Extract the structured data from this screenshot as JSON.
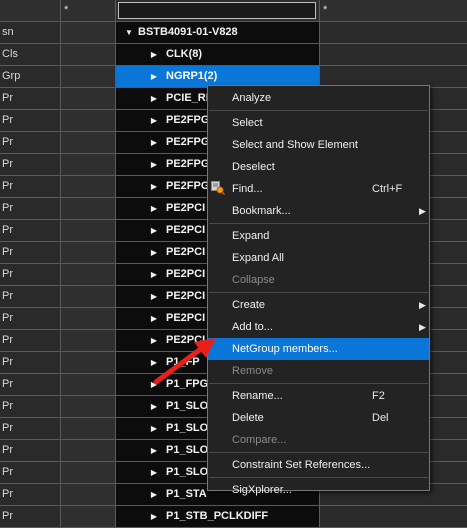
{
  "header": {
    "col1_filter": "*",
    "col3_filter": "*"
  },
  "rows": [
    {
      "c0": "sn",
      "tree": "BSTB4091-01-V828",
      "level": 1,
      "expanded": true
    },
    {
      "c0": "Cls",
      "tree": "CLK(8)",
      "level": 2
    },
    {
      "c0": "Grp",
      "tree": "NGRP1(2)",
      "level": 2,
      "selected": true
    },
    {
      "c0": "Pr",
      "tree": "PCIE_RE",
      "level": 2
    },
    {
      "c0": "Pr",
      "tree": "PE2FPG",
      "level": 2
    },
    {
      "c0": "Pr",
      "tree": "PE2FPG",
      "level": 2
    },
    {
      "c0": "Pr",
      "tree": "PE2FPG",
      "level": 2
    },
    {
      "c0": "Pr",
      "tree": "PE2FPG",
      "level": 2
    },
    {
      "c0": "Pr",
      "tree": "PE2PCI",
      "level": 2
    },
    {
      "c0": "Pr",
      "tree": "PE2PCI",
      "level": 2
    },
    {
      "c0": "Pr",
      "tree": "PE2PCI",
      "level": 2
    },
    {
      "c0": "Pr",
      "tree": "PE2PCI",
      "level": 2
    },
    {
      "c0": "Pr",
      "tree": "PE2PCI",
      "level": 2
    },
    {
      "c0": "Pr",
      "tree": "PE2PCI",
      "level": 2
    },
    {
      "c0": "Pr",
      "tree": "PE2PCI",
      "level": 2
    },
    {
      "c0": "Pr",
      "tree": "P1_FP",
      "level": 2
    },
    {
      "c0": "Pr",
      "tree": "P1_FPG",
      "level": 2
    },
    {
      "c0": "Pr",
      "tree": "P1_SLO",
      "level": 2
    },
    {
      "c0": "Pr",
      "tree": "P1_SLO",
      "level": 2
    },
    {
      "c0": "Pr",
      "tree": "P1_SLO",
      "level": 2
    },
    {
      "c0": "Pr",
      "tree": "P1_SLO",
      "level": 2
    },
    {
      "c0": "Pr",
      "tree": "P1_STA",
      "level": 2
    },
    {
      "c0": "Pr",
      "tree": "P1_STB_PCLKDIFF",
      "level": 2
    }
  ],
  "menu": [
    {
      "label": "Analyze"
    },
    {
      "sep": true
    },
    {
      "label": "Select"
    },
    {
      "label": "Select and Show Element"
    },
    {
      "label": "Deselect"
    },
    {
      "label": "Find...",
      "shortcut": "Ctrl+F",
      "icon": "find-icon"
    },
    {
      "label": "Bookmark...",
      "submenu": true
    },
    {
      "sep": true
    },
    {
      "label": "Expand"
    },
    {
      "label": "Expand All"
    },
    {
      "label": "Collapse",
      "disabled": true
    },
    {
      "sep": true
    },
    {
      "label": "Create",
      "submenu": true
    },
    {
      "label": "Add to...",
      "submenu": true
    },
    {
      "label": "NetGroup members...",
      "highlighted": true
    },
    {
      "label": "Remove",
      "disabled": true
    },
    {
      "sep": true
    },
    {
      "label": "Rename...",
      "shortcut": "F2"
    },
    {
      "label": "Delete",
      "shortcut": "Del"
    },
    {
      "label": "Compare...",
      "disabled": true
    },
    {
      "sep": true
    },
    {
      "label": "Constraint Set References..."
    },
    {
      "sep": true
    },
    {
      "label": "SigXplorer..."
    }
  ],
  "colors": {
    "selection": "#0a76d8",
    "annotation_arrow": "#e8201a"
  }
}
